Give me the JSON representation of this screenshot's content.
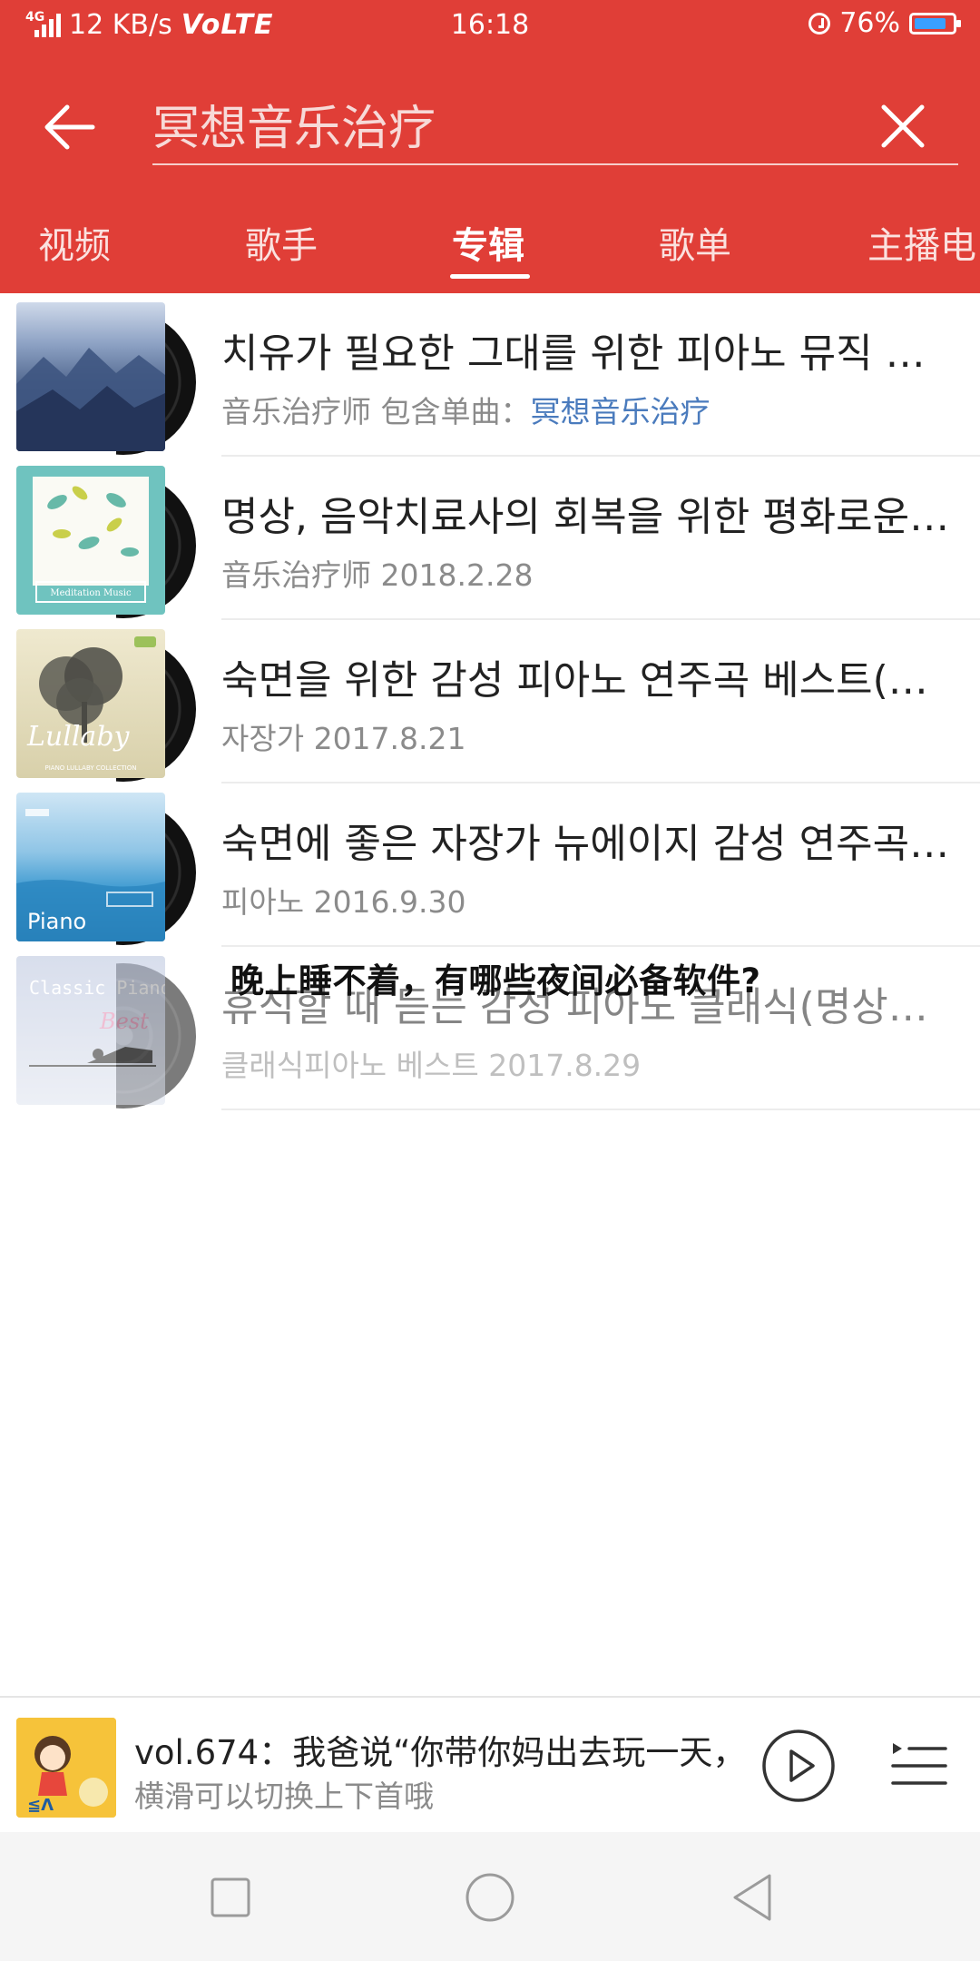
{
  "status_bar": {
    "network": "4G",
    "speed": "12 KB/s",
    "volte": "VoLTE",
    "time": "16:18",
    "battery": "76%"
  },
  "search": {
    "query": "冥想音乐治疗",
    "back_icon": "arrow-left-icon",
    "clear_icon": "close-icon"
  },
  "tabs": [
    {
      "label": "视频"
    },
    {
      "label": "歌手"
    },
    {
      "label": "专辑",
      "active": true
    },
    {
      "label": "歌单"
    },
    {
      "label": "主播电"
    }
  ],
  "albums": [
    {
      "title": "치유가 필요한 그대를 위한 피아노 뮤직 테라피",
      "meta_prefix": "音乐治疗师 包含单曲：",
      "meta_highlight": "冥想音乐治疗"
    },
    {
      "title": "명상, 음악치료사의 회복을 위한 평화로운 음악",
      "meta": "音乐治疗师 2018.2.28",
      "cover_text": "Meditation Music"
    },
    {
      "title": "숙면을 위한 감성 피아노 연주곡 베스트(명상)",
      "meta": "자장가 2017.8.21",
      "cover_text": "Lullaby",
      "cover_sub": "PIANO LULLABY COLLECTION"
    },
    {
      "title": "숙면에 좋은 자장가 뉴에이지 감성 연주곡 모음",
      "meta": "피아노 2016.9.30",
      "cover_text": "Piano"
    },
    {
      "title": "휴식할 때 듣는 감성 피아노 클래식(명상음악)",
      "meta": "클래식피아노 베스트 2017.8.29",
      "cover_text": "Classic Piano",
      "cover_sub": "Best"
    }
  ],
  "overlay_text": "晚上睡不着，有哪些夜间必备软件?",
  "player": {
    "song": "vol.674：我爸说“你带你妈出去玩一天，",
    "hint": "横滑可以切换上下首哦"
  },
  "colors": {
    "header": "#e03e37",
    "highlight": "#4a7bbd"
  }
}
